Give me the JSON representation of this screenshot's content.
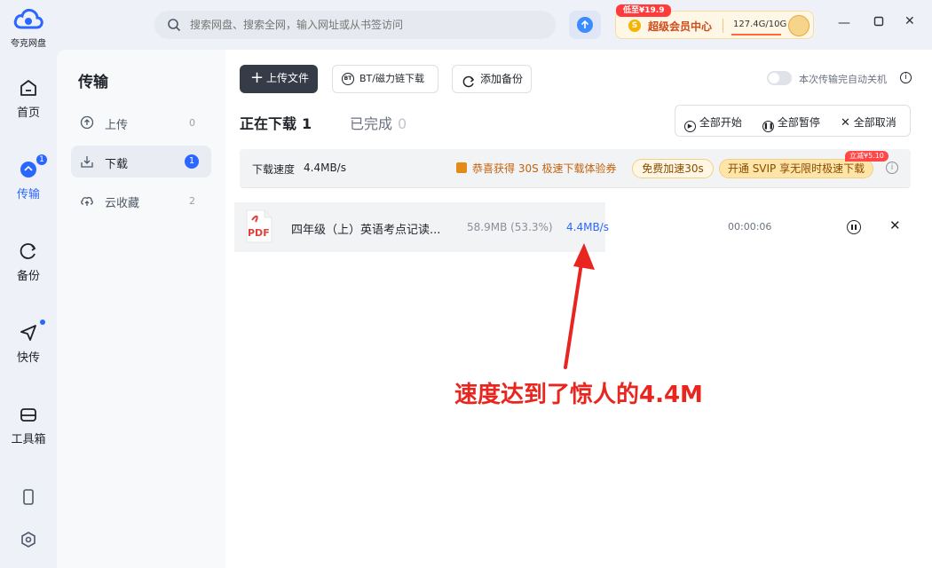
{
  "app": {
    "name": "夸克网盘"
  },
  "nav": {
    "items": [
      {
        "label": "首页",
        "icon": "home-icon"
      },
      {
        "label": "传输",
        "icon": "transfer-icon",
        "badge": "1"
      },
      {
        "label": "备份",
        "icon": "backup-icon"
      },
      {
        "label": "快传",
        "icon": "quick-send-icon"
      },
      {
        "label": "工具箱",
        "icon": "toolbox-icon"
      }
    ],
    "bottom_icons": [
      "phone-icon",
      "settings-icon"
    ]
  },
  "topbar": {
    "search_placeholder": "搜索网盘、搜索全网，输入网址或从书签访问",
    "vip_promo": "低至¥19.9",
    "vip_badge": "S",
    "vip_label": "超级会员中心",
    "storage": "127.4G/10G"
  },
  "sidebar": {
    "title": "传输",
    "items": [
      {
        "label": "上传",
        "count": "0",
        "icon": "upload-icon"
      },
      {
        "label": "下载",
        "count": "1",
        "icon": "download-icon"
      },
      {
        "label": "云收藏",
        "count": "2",
        "icon": "cloud-save-icon"
      }
    ]
  },
  "toolbar": {
    "upload_file": "上传文件",
    "bt_download": "BT/磁力链下载",
    "bt_badge": "BT",
    "add_backup": "添加备份",
    "auto_shutdown": "本次传输完自动关机"
  },
  "tabs": [
    {
      "label": "正在下载",
      "count": "1"
    },
    {
      "label": "已完成",
      "count": "0"
    }
  ],
  "actions": {
    "start_all": "全部开始",
    "pause_all": "全部暂停",
    "cancel_all": "全部取消"
  },
  "speed_bar": {
    "label": "下载速度",
    "value": "4.4MB/s",
    "gift_text": "恭喜获得 30S 极速下载体验券",
    "free_boost": "免费加速30s",
    "svip_offer": "开通 SVIP 享无限时极速下载",
    "discount_tag": "立减¥5.10"
  },
  "download_rows": [
    {
      "file_type": "PDF",
      "name": "四年级（上）英语考点记读...",
      "size_progress": "58.9MB (53.3%)",
      "speed": "4.4MB/s",
      "time": "00:00:06"
    }
  ],
  "annotation": {
    "text": "速度达到了惊人的4.4M",
    "color": "#e8251e"
  },
  "colors": {
    "accent": "#2b66ff",
    "dark_button": "#363b48"
  }
}
